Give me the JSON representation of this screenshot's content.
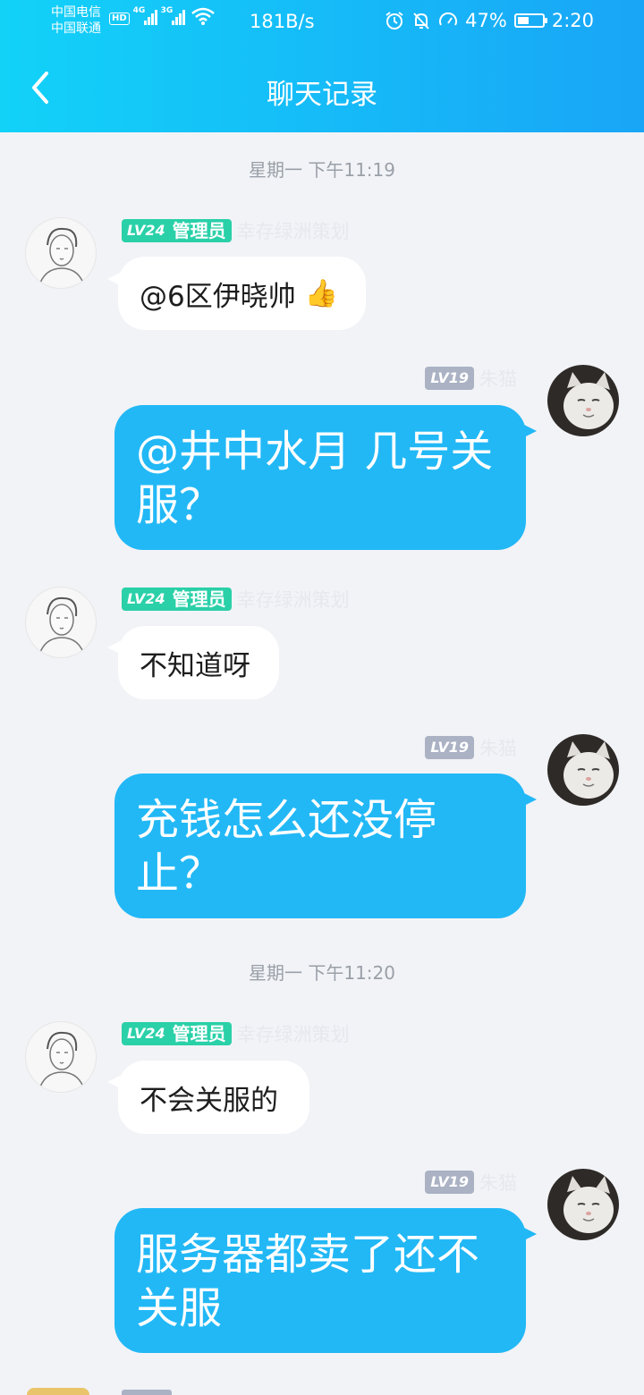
{
  "status": {
    "carrier1": "中国电信",
    "carrier2": "中国联通",
    "hd": "HD",
    "net1": "4G",
    "net2": "3G",
    "speed": "181B/s",
    "battery": "47%",
    "battery_level": 0.47,
    "time": "2:20"
  },
  "header": {
    "title": "聊天记录"
  },
  "timestamps": [
    "星期一 下午11:19",
    "星期一 下午11:20"
  ],
  "messages": [
    {
      "side": "left",
      "level": "LV24",
      "role": "管理员",
      "sender": "幸存绿洲策划",
      "text": "@6区伊晓帅",
      "emoji": "👍"
    },
    {
      "side": "right",
      "level": "LV19",
      "sender": "朱猫",
      "text": "@井中水月 几号关服？"
    },
    {
      "side": "left",
      "level": "LV24",
      "role": "管理员",
      "sender": "幸存绿洲策划",
      "text": "不知道呀"
    },
    {
      "side": "right",
      "level": "LV19",
      "sender": "朱猫",
      "text": "充钱怎么还没停止？"
    },
    {
      "side": "left",
      "level": "LV24",
      "role": "管理员",
      "sender": "幸存绿洲策划",
      "text": "不会关服的"
    },
    {
      "side": "right",
      "level": "LV19",
      "sender": "朱猫",
      "text": "服务器都卖了还不关服"
    }
  ]
}
